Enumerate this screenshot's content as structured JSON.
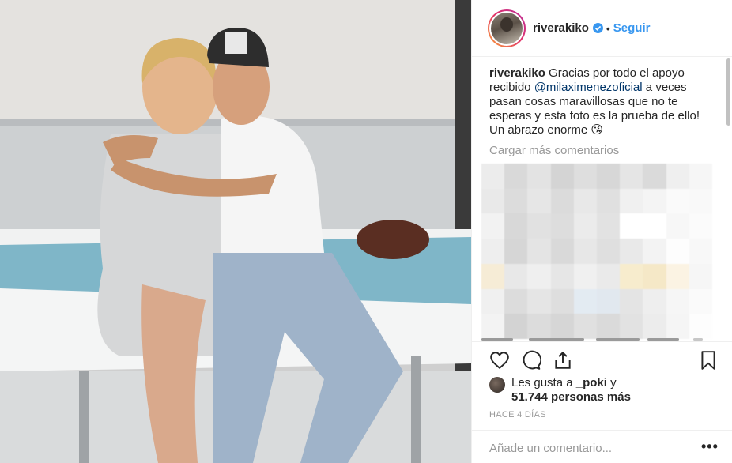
{
  "post": {
    "username": "riverakiko",
    "follow_label": "Seguir",
    "separator": "•"
  },
  "caption": {
    "user": "riverakiko",
    "text_1": " Gracias por todo el apoyo recibido ",
    "mention": "@milaximenezoficial",
    "text_2": " a veces pasan cosas maravillosas que no te esperas y esta foto es la prueba de ello! Un abrazo enorme ",
    "emoji": "😘"
  },
  "comments": {
    "load_more_label": "Cargar más comentarios"
  },
  "likes": {
    "prefix": "Les gusta a ",
    "user": "_poki",
    "suffix": " y",
    "count_text": "51.744 personas más"
  },
  "timestamp": "HACE 4 DÍAS",
  "add_comment": {
    "placeholder": "Añade un comentario...",
    "more_label": "•••"
  },
  "icons": {
    "verified": "verified-badge-icon",
    "like": "heart-icon",
    "comment": "comment-icon",
    "share": "share-icon",
    "save": "bookmark-icon"
  },
  "colors": {
    "accent": "#3897f0",
    "mention": "#003569",
    "muted": "#999999",
    "border": "#efefef"
  }
}
